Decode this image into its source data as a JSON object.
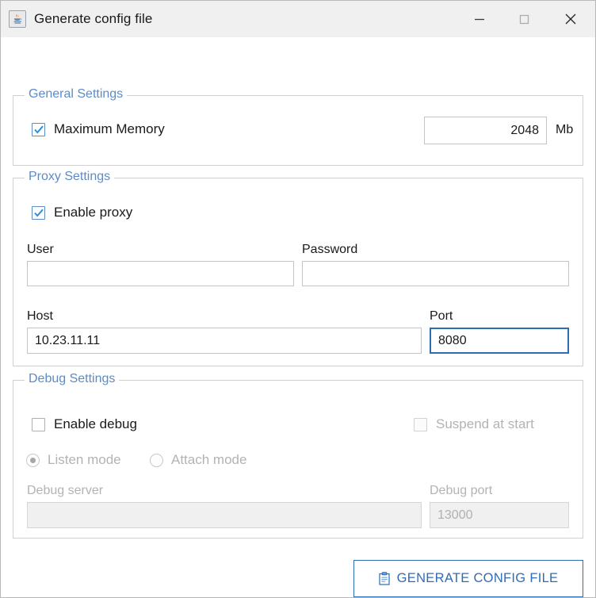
{
  "window": {
    "title": "Generate config file",
    "icon": "java-coffee-cup-icon",
    "controls": {
      "minimize": "minimize-icon",
      "maximize": "maximize-icon",
      "close": "close-icon"
    },
    "accent_color": "#2f6cb5",
    "group_title_color": "#5b8cc8",
    "titlebar_color": "#f0f0f0",
    "background_color": "#ffffff",
    "disabled_text_color": "#b3b3b3"
  },
  "general_settings": {
    "legend": "General Settings",
    "maximum_memory": {
      "label": "Maximum Memory",
      "checked": true,
      "value": "2048",
      "unit": "Mb"
    }
  },
  "proxy_settings": {
    "legend": "Proxy Settings",
    "enable_proxy": {
      "label": "Enable proxy",
      "checked": true
    },
    "user": {
      "label": "User",
      "value": "",
      "placeholder": ""
    },
    "password": {
      "label": "Password",
      "value": "",
      "placeholder": ""
    },
    "host": {
      "label": "Host",
      "value": "10.23.11.11",
      "placeholder": ""
    },
    "port": {
      "label": "Port",
      "value": "8080",
      "placeholder": "",
      "focused": true
    }
  },
  "debug_settings": {
    "legend": "Debug Settings",
    "enable_debug": {
      "label": "Enable debug",
      "checked": false
    },
    "suspend_at_start": {
      "label": "Suspend at start",
      "checked": false,
      "disabled": true
    },
    "mode": {
      "listen": {
        "label": "Listen mode",
        "selected": true,
        "disabled": true
      },
      "attach": {
        "label": "Attach mode",
        "selected": false,
        "disabled": true
      }
    },
    "debug_server": {
      "label": "Debug server",
      "value": "",
      "placeholder": "",
      "disabled": true
    },
    "debug_port": {
      "label": "Debug port",
      "value": "13000",
      "placeholder": "",
      "disabled": true
    }
  },
  "actions": {
    "generate": {
      "label": "GENERATE CONFIG FILE",
      "icon": "clipboard-icon"
    }
  }
}
